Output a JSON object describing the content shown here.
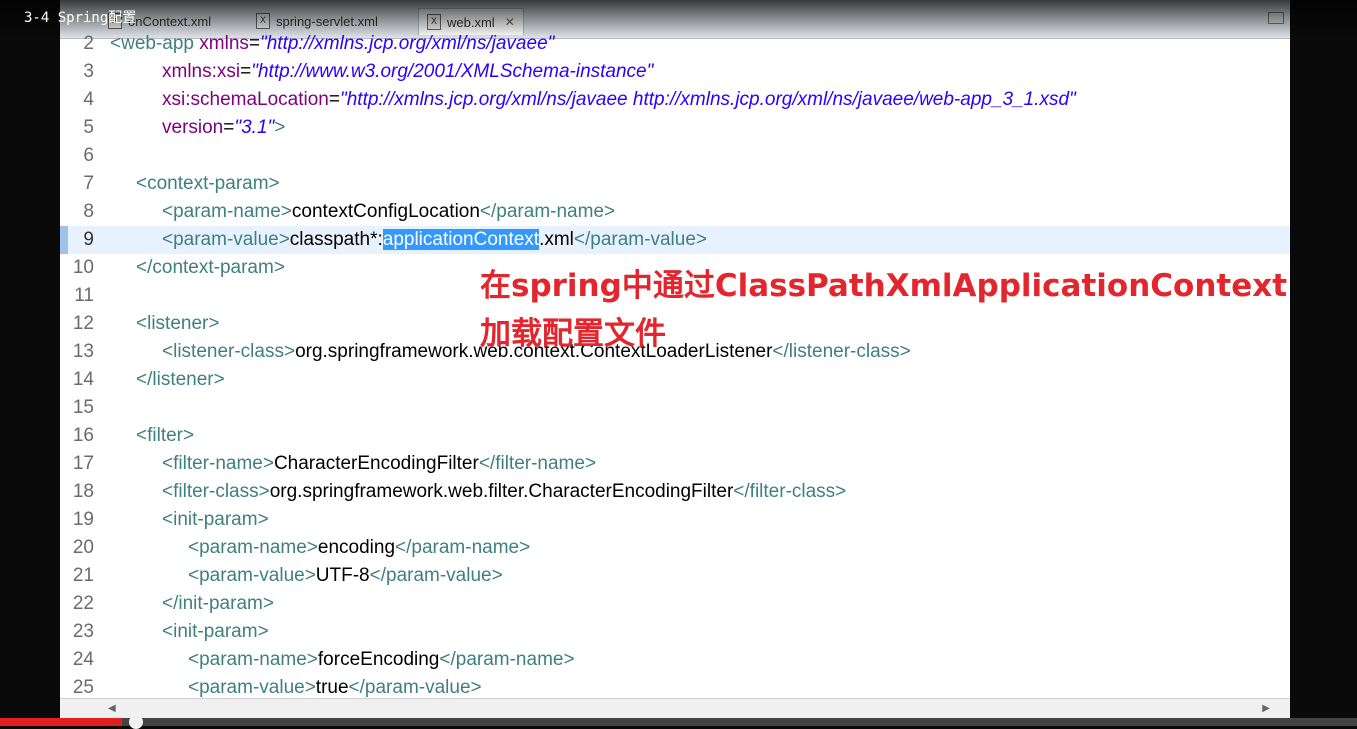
{
  "video": {
    "title": "3-4 Spring配置",
    "progress": 0.09
  },
  "tabs": [
    {
      "label": "onContext.xml",
      "icon": "xml-file-icon",
      "active": false
    },
    {
      "label": "spring-servlet.xml",
      "icon": "xml-file-icon",
      "active": false
    },
    {
      "label": "web.xml",
      "icon": "xml-file-icon",
      "active": true,
      "close": "✕"
    }
  ],
  "file_icon_glyph": "X",
  "colors": {
    "tag": "#3f7f7f",
    "attr_name": "#7f007f",
    "attr_value": "#2a00ff",
    "selection": "#3399ff",
    "annotation": "#e3262d",
    "current_line": "#e8f2fe"
  },
  "annotation": {
    "line1": "在spring中通过ClassPathXmlApplicationContext",
    "line2": "加载配置文件"
  },
  "code": {
    "current_line": 9,
    "lines": [
      {
        "n": "2",
        "indent": 0,
        "segs": [
          [
            "tg",
            "<web-app "
          ],
          [
            "an",
            "xmlns"
          ],
          [
            "tx",
            "="
          ],
          [
            "av",
            "\"http://xmlns.jcp.org/xml/ns/javaee\""
          ]
        ]
      },
      {
        "n": "3",
        "indent": 2,
        "segs": [
          [
            "an",
            "xmlns:xsi"
          ],
          [
            "tx",
            "="
          ],
          [
            "av",
            "\"http://www.w3.org/2001/XMLSchema-instance\""
          ]
        ]
      },
      {
        "n": "4",
        "indent": 2,
        "segs": [
          [
            "an",
            "xsi:schemaLocation"
          ],
          [
            "tx",
            "="
          ],
          [
            "av",
            "\"http://xmlns.jcp.org/xml/ns/javaee http://xmlns.jcp.org/xml/ns/javaee/web-app_3_1.xsd\""
          ]
        ]
      },
      {
        "n": "5",
        "indent": 2,
        "segs": [
          [
            "an",
            "version"
          ],
          [
            "tx",
            "="
          ],
          [
            "av",
            "\"3.1\""
          ],
          [
            "tg",
            ">"
          ]
        ]
      },
      {
        "n": "6",
        "indent": 0,
        "segs": []
      },
      {
        "n": "7",
        "indent": 1,
        "segs": [
          [
            "tg",
            "<context-param>"
          ]
        ]
      },
      {
        "n": "8",
        "indent": 2,
        "segs": [
          [
            "tg",
            "<param-name>"
          ],
          [
            "tx",
            "contextConfigLocation"
          ],
          [
            "tg",
            "</param-name>"
          ]
        ]
      },
      {
        "n": "9",
        "indent": 2,
        "segs": [
          [
            "tg",
            "<param-value>"
          ],
          [
            "tx",
            "classpath*:"
          ],
          [
            "sel",
            "applicationContext"
          ],
          [
            "tx",
            ".xml"
          ],
          [
            "tg",
            "</param-value>"
          ]
        ]
      },
      {
        "n": "10",
        "indent": 1,
        "segs": [
          [
            "tg",
            "</context-param>"
          ]
        ]
      },
      {
        "n": "11",
        "indent": 0,
        "segs": []
      },
      {
        "n": "12",
        "indent": 1,
        "segs": [
          [
            "tg",
            "<listener>"
          ]
        ]
      },
      {
        "n": "13",
        "indent": 2,
        "segs": [
          [
            "tg",
            "<listener-class>"
          ],
          [
            "tx",
            "org.springframework.web.context.ContextLoaderListener"
          ],
          [
            "tg",
            "</listener-class>"
          ]
        ]
      },
      {
        "n": "14",
        "indent": 1,
        "segs": [
          [
            "tg",
            "</listener>"
          ]
        ]
      },
      {
        "n": "15",
        "indent": 0,
        "segs": []
      },
      {
        "n": "16",
        "indent": 1,
        "segs": [
          [
            "tg",
            "<filter>"
          ]
        ]
      },
      {
        "n": "17",
        "indent": 2,
        "segs": [
          [
            "tg",
            "<filter-name>"
          ],
          [
            "tx",
            "CharacterEncodingFilter"
          ],
          [
            "tg",
            "</filter-name>"
          ]
        ]
      },
      {
        "n": "18",
        "indent": 2,
        "segs": [
          [
            "tg",
            "<filter-class>"
          ],
          [
            "tx",
            "org.springframework.web.filter.CharacterEncodingFilter"
          ],
          [
            "tg",
            "</filter-class>"
          ]
        ]
      },
      {
        "n": "19",
        "indent": 2,
        "segs": [
          [
            "tg",
            "<init-param>"
          ]
        ]
      },
      {
        "n": "20",
        "indent": 3,
        "segs": [
          [
            "tg",
            "<param-name>"
          ],
          [
            "tx",
            "encoding"
          ],
          [
            "tg",
            "</param-name>"
          ]
        ]
      },
      {
        "n": "21",
        "indent": 3,
        "segs": [
          [
            "tg",
            "<param-value>"
          ],
          [
            "tx",
            "UTF-8"
          ],
          [
            "tg",
            "</param-value>"
          ]
        ]
      },
      {
        "n": "22",
        "indent": 2,
        "segs": [
          [
            "tg",
            "</init-param>"
          ]
        ]
      },
      {
        "n": "23",
        "indent": 2,
        "segs": [
          [
            "tg",
            "<init-param>"
          ]
        ]
      },
      {
        "n": "24",
        "indent": 3,
        "segs": [
          [
            "tg",
            "<param-name>"
          ],
          [
            "tx",
            "forceEncoding"
          ],
          [
            "tg",
            "</param-name>"
          ]
        ]
      },
      {
        "n": "25",
        "indent": 3,
        "segs": [
          [
            "tg",
            "<param-value>"
          ],
          [
            "tx",
            "true"
          ],
          [
            "tg",
            "</param-value>"
          ]
        ]
      }
    ]
  }
}
